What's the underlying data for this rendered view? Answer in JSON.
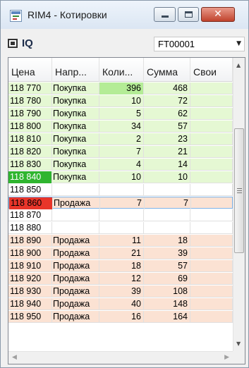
{
  "window": {
    "title": "RIM4 - Котировки",
    "close_glyph": "✕"
  },
  "toolbar": {
    "instrument_label": "IQ",
    "account_value": "FT00001",
    "dropdown_glyph": "▼"
  },
  "table": {
    "columns": [
      "Цена",
      "Напр...",
      "Коли...",
      "Сумма",
      "Свои"
    ],
    "sort_indicator": "^",
    "colors": {
      "buy_bg": "#e5f8d3",
      "sell_bg": "#fbe2d3",
      "best_buy_price_bg": "#2fb52f",
      "best_sell_price_bg": "#e8352a",
      "max_buy_qty_bg": "#b4ec96"
    },
    "rows": [
      {
        "price": "118 770",
        "direction": "Покупка",
        "qty": "396",
        "sum": "468",
        "own": "",
        "side": "buy"
      },
      {
        "price": "118 780",
        "direction": "Покупка",
        "qty": "10",
        "sum": "72",
        "own": "",
        "side": "buy"
      },
      {
        "price": "118 790",
        "direction": "Покупка",
        "qty": "5",
        "sum": "62",
        "own": "",
        "side": "buy"
      },
      {
        "price": "118 800",
        "direction": "Покупка",
        "qty": "34",
        "sum": "57",
        "own": "",
        "side": "buy"
      },
      {
        "price": "118 810",
        "direction": "Покупка",
        "qty": "2",
        "sum": "23",
        "own": "",
        "side": "buy"
      },
      {
        "price": "118 820",
        "direction": "Покупка",
        "qty": "7",
        "sum": "21",
        "own": "",
        "side": "buy"
      },
      {
        "price": "118 830",
        "direction": "Покупка",
        "qty": "4",
        "sum": "14",
        "own": "",
        "side": "buy"
      },
      {
        "price": "118 840",
        "direction": "Покупка",
        "qty": "10",
        "sum": "10",
        "own": "",
        "side": "buy"
      },
      {
        "price": "118 850",
        "direction": "",
        "qty": "",
        "sum": "",
        "own": "",
        "side": "empty"
      },
      {
        "price": "118 860",
        "direction": "Продажа",
        "qty": "7",
        "sum": "7",
        "own": "",
        "side": "sell"
      },
      {
        "price": "118 870",
        "direction": "",
        "qty": "",
        "sum": "",
        "own": "",
        "side": "empty"
      },
      {
        "price": "118 880",
        "direction": "",
        "qty": "",
        "sum": "",
        "own": "",
        "side": "empty"
      },
      {
        "price": "118 890",
        "direction": "Продажа",
        "qty": "11",
        "sum": "18",
        "own": "",
        "side": "sell"
      },
      {
        "price": "118 900",
        "direction": "Продажа",
        "qty": "21",
        "sum": "39",
        "own": "",
        "side": "sell"
      },
      {
        "price": "118 910",
        "direction": "Продажа",
        "qty": "18",
        "sum": "57",
        "own": "",
        "side": "sell"
      },
      {
        "price": "118 920",
        "direction": "Продажа",
        "qty": "12",
        "sum": "69",
        "own": "",
        "side": "sell"
      },
      {
        "price": "118 930",
        "direction": "Продажа",
        "qty": "39",
        "sum": "108",
        "own": "",
        "side": "sell"
      },
      {
        "price": "118 940",
        "direction": "Продажа",
        "qty": "40",
        "sum": "148",
        "own": "",
        "side": "sell"
      },
      {
        "price": "118 950",
        "direction": "Продажа",
        "qty": "16",
        "sum": "164",
        "own": "",
        "side": "sell"
      }
    ]
  },
  "scrollbars": {
    "up_glyph": "▲",
    "down_glyph": "▼",
    "left_glyph": "◀",
    "right_glyph": "▶"
  }
}
